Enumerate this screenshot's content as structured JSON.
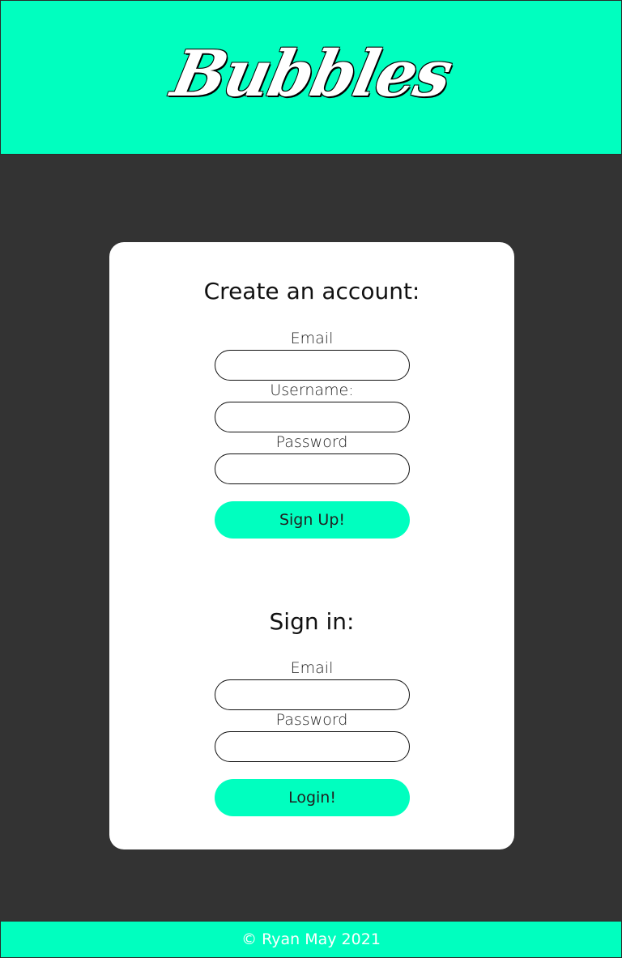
{
  "header": {
    "logo_text": "Bubbles"
  },
  "signup": {
    "title": "Create an account:",
    "email_label": "Email",
    "email_value": "",
    "username_label": "Username:",
    "username_value": "",
    "password_label": "Password",
    "password_value": "",
    "button_label": "Sign Up!"
  },
  "signin": {
    "title": "Sign in:",
    "email_label": "Email",
    "email_value": "",
    "password_label": "Password",
    "password_value": "",
    "button_label": "Login!"
  },
  "footer": {
    "text": "© Ryan May 2021"
  },
  "colors": {
    "accent": "#00ffbf",
    "background": "#333333",
    "card": "#ffffff"
  }
}
